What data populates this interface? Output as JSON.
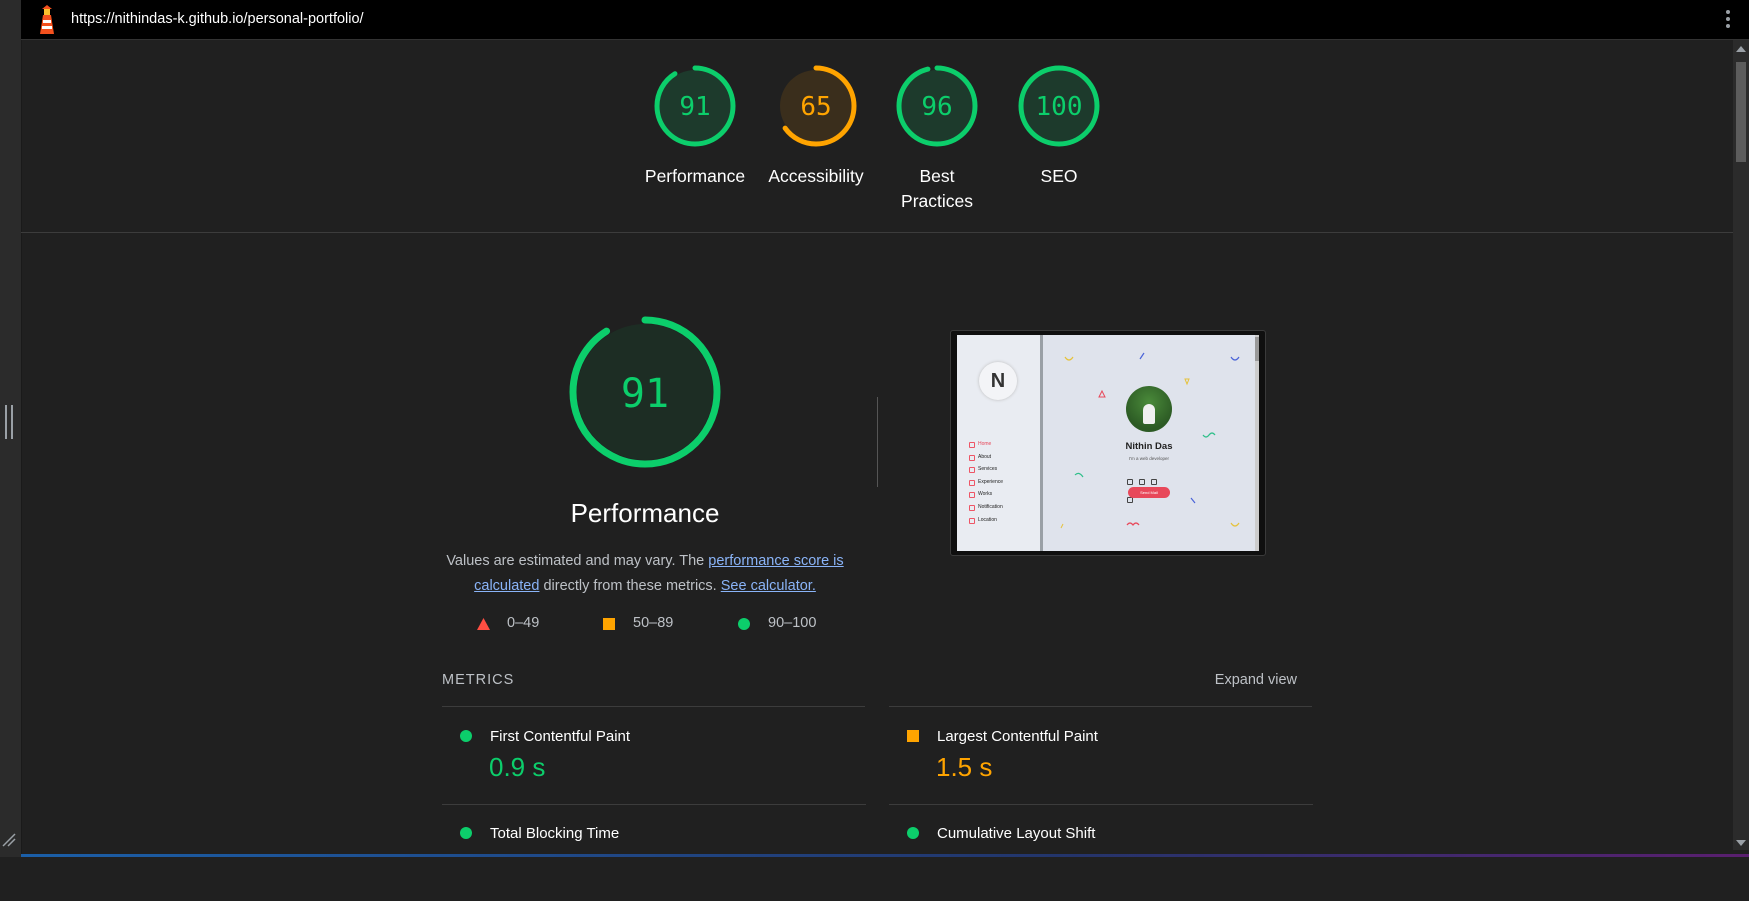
{
  "topbar": {
    "url": "https://nithindas-k.github.io/personal-portfolio/"
  },
  "summary": {
    "gauges": [
      {
        "score": "91",
        "label": "Performance",
        "value": 0.91,
        "color": "#0cce6b"
      },
      {
        "score": "65",
        "label": "Accessibility",
        "value": 0.65,
        "color": "#ffa400"
      },
      {
        "score": "96",
        "label_line1": "Best",
        "label_line2": "Practices",
        "value": 0.96,
        "color": "#0cce6b"
      },
      {
        "score": "100",
        "label": "SEO",
        "value": 1.0,
        "color": "#0cce6b"
      }
    ]
  },
  "performance": {
    "score": "91",
    "value": 0.91,
    "title": "Performance",
    "desc_pre": "Values are estimated and may vary. The ",
    "desc_link1": "performance score is calculated",
    "desc_mid": " directly from these metrics. ",
    "desc_link2": "See calculator."
  },
  "legend": {
    "fail": "0–49",
    "average": "50–89",
    "pass": "90–100"
  },
  "screenshot": {
    "logo_letter": "N",
    "nav": [
      "Home",
      "About",
      "Services",
      "Experience",
      "Works",
      "Notification",
      "Location"
    ],
    "name": "Nithin Das",
    "role": "I'm a web developer",
    "button": "Send Mail"
  },
  "metrics": {
    "title": "METRICS",
    "expand": "Expand view",
    "items": [
      {
        "label": "First Contentful Paint",
        "value": "0.9 s",
        "status": "pass"
      },
      {
        "label": "Largest Contentful Paint",
        "value": "1.5 s",
        "status": "average"
      },
      {
        "label": "Total Blocking Time",
        "value": "",
        "status": "pass"
      },
      {
        "label": "Cumulative Layout Shift",
        "value": "",
        "status": "pass"
      }
    ]
  },
  "colors": {
    "pass": "#0cce6b",
    "average": "#ffa400",
    "fail": "#ff4e42",
    "link": "#8ab4f8"
  }
}
